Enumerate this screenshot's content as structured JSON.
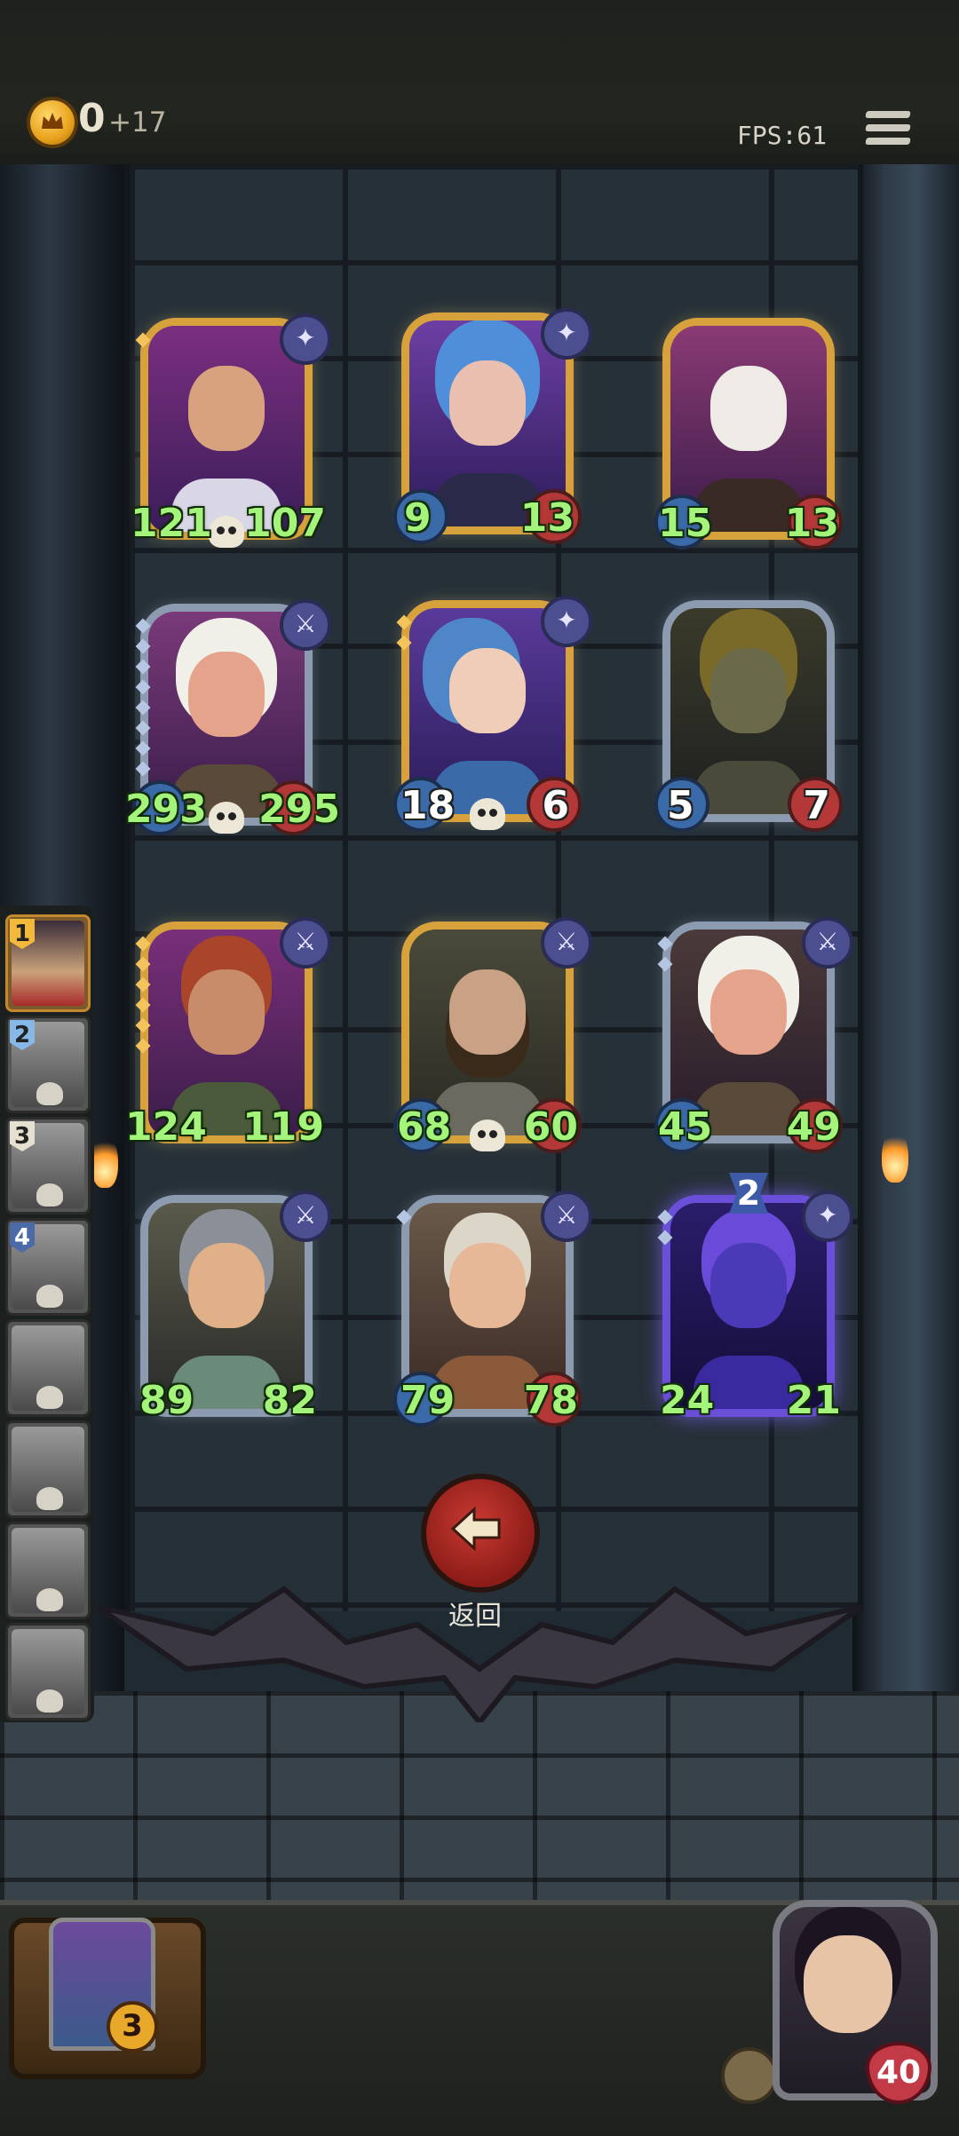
{
  "hud": {
    "gold": "0",
    "gold_income": "+17",
    "fps": "FPS:61"
  },
  "cards": [
    {
      "id": "king",
      "atk": "121",
      "hp": "107",
      "frame": "gold",
      "skull": true,
      "badge": "star-icon"
    },
    {
      "id": "sorceress",
      "atk": "9",
      "hp": "13",
      "frame": "gold",
      "skull": false,
      "badge": "star-icon"
    },
    {
      "id": "rat",
      "atk": "15",
      "hp": "13",
      "frame": "gold",
      "skull": false,
      "badge": "none"
    },
    {
      "id": "goblin-elder",
      "atk": "293",
      "hp": "295",
      "frame": "silver",
      "skull": true,
      "badge": "sword-icon"
    },
    {
      "id": "elf-archer",
      "atk": "18",
      "hp": "6",
      "frame": "gold",
      "skull": true,
      "badge": "star-icon"
    },
    {
      "id": "witch",
      "atk": "5",
      "hp": "7",
      "frame": "silver",
      "skull": false,
      "badge": "none"
    },
    {
      "id": "brute",
      "atk": "124",
      "hp": "119",
      "frame": "gold",
      "skull": false,
      "badge": "sword-icon"
    },
    {
      "id": "warrior",
      "atk": "68",
      "hp": "60",
      "frame": "gold",
      "skull": true,
      "badge": "sword-icon"
    },
    {
      "id": "goblin-elder-2",
      "atk": "45",
      "hp": "49",
      "frame": "silver",
      "skull": false,
      "badge": "sword-icon"
    },
    {
      "id": "knight",
      "atk": "89",
      "hp": "82",
      "frame": "silver",
      "skull": false,
      "badge": "sword-icon"
    },
    {
      "id": "cook",
      "atk": "79",
      "hp": "78",
      "frame": "silver",
      "skull": false,
      "badge": "sword-icon"
    },
    {
      "id": "void-stag",
      "atk": "24",
      "hp": "21",
      "frame": "purple",
      "skull": false,
      "badge": "star-icon",
      "tier": "2"
    }
  ],
  "queue": [
    {
      "num": "1",
      "style": "gold",
      "active": true
    },
    {
      "num": "2",
      "style": "blue",
      "active": false
    },
    {
      "num": "3",
      "style": "plain",
      "active": false
    },
    {
      "num": "4",
      "style": "dark",
      "active": false
    },
    {
      "num": "",
      "style": "",
      "active": false
    },
    {
      "num": "",
      "style": "",
      "active": false
    },
    {
      "num": "",
      "style": "",
      "active": false
    },
    {
      "num": "",
      "style": "",
      "active": false
    }
  ],
  "back_label": "返回",
  "chest_count": "3",
  "hero_hp": "40"
}
